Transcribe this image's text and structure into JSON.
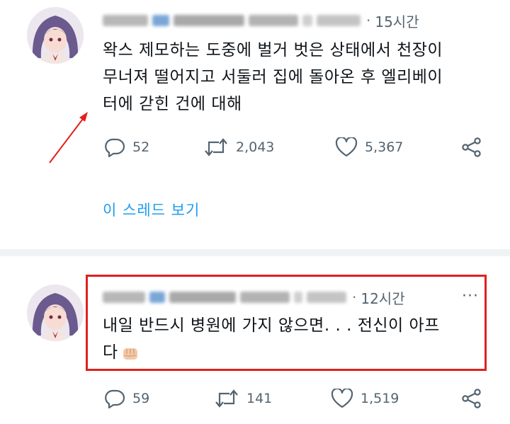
{
  "tweets": [
    {
      "time": "15시간",
      "text_line1": "왁스 제모하는 도중에 벌거 벗은 상태에서 천장이",
      "text_line2": "무너져 떨어지고 서둘러 집에 돌아온 후 엘리베이",
      "text_line3": "터에 갇힌 건에 대해",
      "replies": "52",
      "retweets": "2,043",
      "likes": "5,367",
      "thread_link": "이 스레드 보기"
    },
    {
      "time": "12시간",
      "more": "···",
      "text_line1": "내일 반드시 병원에 가지 않으면. . . 전신이 아프",
      "text_line2": "다",
      "replies": "59",
      "retweets": "141",
      "likes": "1,519"
    }
  ],
  "colors": {
    "accent": "#1d9bf0",
    "annotation_red": "#e02020",
    "muted": "#536471"
  },
  "icons": [
    "reply-icon",
    "retweet-icon",
    "like-icon",
    "share-icon",
    "fist-emoji"
  ]
}
